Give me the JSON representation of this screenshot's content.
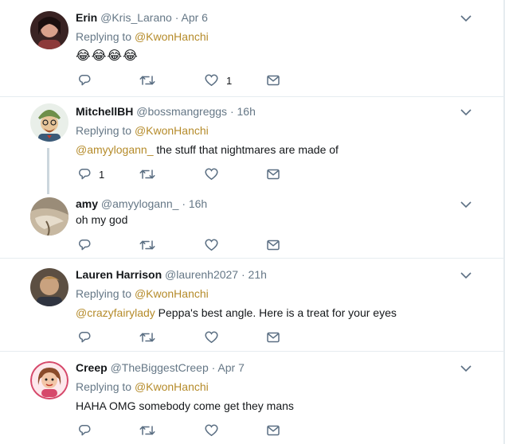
{
  "tweets": [
    {
      "name": "Erin",
      "handle": "@Kris_Larano",
      "time": "· Apr 6",
      "replying_prefix": "Replying to",
      "replying_handle": "@KwonHanchi",
      "mention": "",
      "text": "😂😂😂😂",
      "reply_count": "",
      "like_count": "1",
      "avatar_colors": [
        "#6b3b3b",
        "#d9a18c"
      ]
    },
    {
      "name": "MitchellBH",
      "handle": "@bossmangreggs",
      "time": "· 16h",
      "replying_prefix": "Replying to",
      "replying_handle": "@KwonHanchi",
      "mention": "@amyylogann_",
      "text": " the stuff that nightmares are made of",
      "reply_count": "1",
      "like_count": "",
      "avatar_colors": [
        "#6e8f4a",
        "#e8c59a"
      ]
    },
    {
      "name": "amy",
      "handle": "@amyylogann_",
      "time": "· 16h",
      "replying_prefix": "",
      "replying_handle": "",
      "mention": "",
      "text": "oh my god",
      "reply_count": "",
      "like_count": "",
      "avatar_colors": [
        "#8a7a66",
        "#c7b8a1"
      ]
    },
    {
      "name": "Lauren Harrison",
      "handle": "@laurenh2027",
      "time": "· 21h",
      "replying_prefix": "Replying to",
      "replying_handle": "@KwonHanchi",
      "mention": "@crazyfairylady",
      "text": " Peppa's best angle. Here is a treat for your eyes",
      "reply_count": "",
      "like_count": "",
      "avatar_colors": [
        "#7a6a5a",
        "#c9a27f"
      ]
    },
    {
      "name": "Creep",
      "handle": "@TheBiggestCreep",
      "time": "· Apr 7",
      "replying_prefix": "Replying to",
      "replying_handle": "@KwonHanchi",
      "mention": "",
      "text": "HAHA OMG somebody come get they mans",
      "reply_count": "",
      "like_count": "",
      "avatar_colors": [
        "#d6496b",
        "#f2c6a8"
      ]
    }
  ],
  "icons": {
    "reply": "reply-icon",
    "retweet": "retweet-icon",
    "like": "like-icon",
    "dm": "direct-message-icon",
    "more": "chevron-down-icon"
  },
  "colors": {
    "link": "#b58b2a",
    "muted": "#657786",
    "icon": "#5b6f83",
    "separator": "#e6ecf0"
  }
}
